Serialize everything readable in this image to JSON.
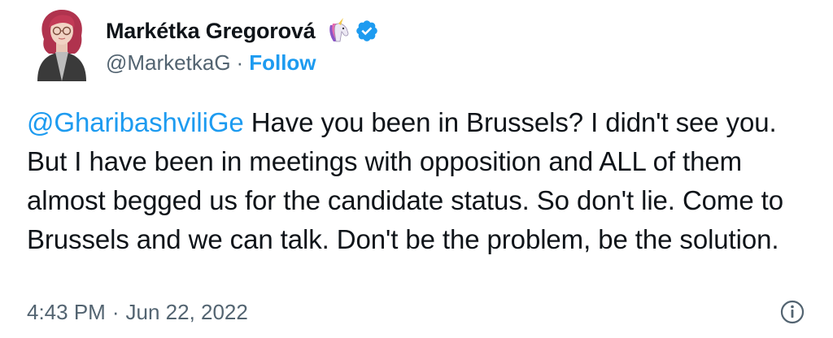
{
  "author": {
    "display_name": "Markétka Gregorová",
    "handle": "@MarketkaG",
    "separator": "·",
    "follow_label": "Follow",
    "emoji_icon": "unicorn-icon",
    "verified_icon": "verified-badge-icon"
  },
  "tweet": {
    "mention": "@GharibashviliGe",
    "text": " Have you been in Brussels? I didn't see you. But I have been in meetings with opposition and ALL of them almost begged us for the candidate status. So don't lie. Come to Brussels and we can talk. Don't be the problem, be the solution."
  },
  "meta": {
    "time": "4:43 PM",
    "separator": "·",
    "date": "Jun 22, 2022",
    "info_icon": "info-icon"
  },
  "colors": {
    "link": "#1d9bf0",
    "text": "#0f1419",
    "secondary": "#536471"
  }
}
